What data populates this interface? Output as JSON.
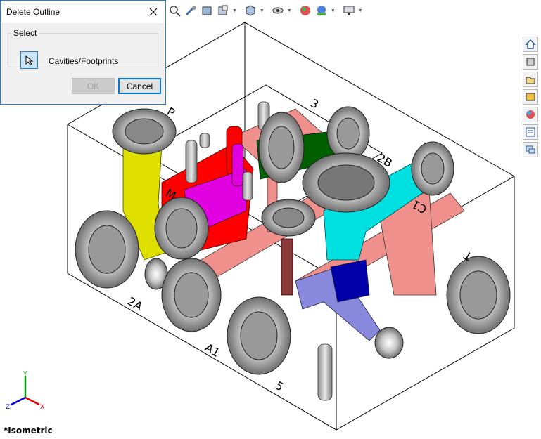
{
  "dialog": {
    "title": "Delete Outline",
    "group_label": "Select",
    "selection_item": "Cavities/Footprints",
    "ok_label": "OK",
    "cancel_label": "Cancel"
  },
  "view": {
    "orientation_label": "*Isometric"
  },
  "triad": {
    "x": "X",
    "y": "Y",
    "z": "Z"
  },
  "port_labels": {
    "p": "P",
    "t": "T",
    "a1": "A1",
    "a2": "2A",
    "b": "2B",
    "c": "C1",
    "n3": "3",
    "n5": "5",
    "m": "M"
  },
  "toolbar": {
    "icons": [
      "zoom-fit-icon",
      "zoom-area-icon",
      "previous-view-icon",
      "section-view-icon",
      "view-orientation-icon",
      "display-style-icon",
      "hide-show-icon",
      "edit-appearance-icon",
      "apply-scene-icon",
      "view-settings-icon"
    ]
  },
  "task_pane": {
    "icons": [
      "home-icon",
      "resources-icon",
      "file-explorer-icon",
      "design-library-icon",
      "appearances-icon",
      "properties-icon",
      "forum-icon"
    ]
  },
  "colors": {
    "accent": "#2b79d0",
    "yellow": "#e0e000",
    "red": "#ff0000",
    "magenta": "#e000e0",
    "green": "#006000",
    "cyan": "#00e0e0",
    "pink": "#f08a8a",
    "brown": "#8b3a3a",
    "lavender": "#8888dd",
    "navy": "#0000aa"
  }
}
